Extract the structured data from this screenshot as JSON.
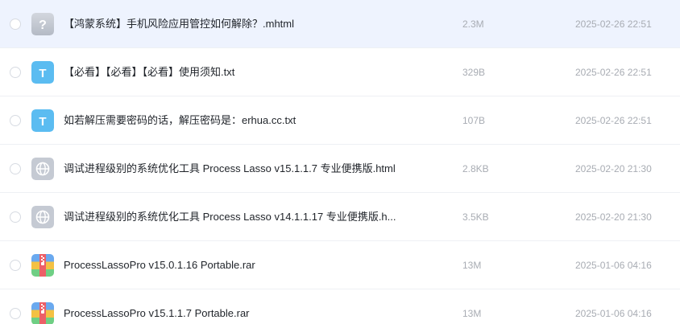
{
  "colors": {
    "selected_row_bg": "#eef3fe",
    "text_icon_bg": "#5bbcf1",
    "unknown_icon_bg": "#c2c7d1",
    "web_icon_bg": "#c5cad3",
    "secondary_text": "#a8acb3"
  },
  "files": [
    {
      "name": "【鸿蒙系统】手机风险应用管控如何解除？.mhtml",
      "size": "2.3M",
      "date": "2025-02-26 22:51",
      "icon": "unknown-file-icon",
      "selected": true
    },
    {
      "name": "【必看】【必看】【必看】使用须知.txt",
      "size": "329B",
      "date": "2025-02-26 22:51",
      "icon": "text-file-icon",
      "selected": false
    },
    {
      "name": "如若解压需要密码的话，解压密码是：erhua.cc.txt",
      "size": "107B",
      "date": "2025-02-26 22:51",
      "icon": "text-file-icon",
      "selected": false
    },
    {
      "name": "调试进程级别的系统优化工具 Process Lasso v15.1.1.7 专业便携版.html",
      "size": "2.8KB",
      "date": "2025-02-20 21:30",
      "icon": "web-file-icon",
      "selected": false
    },
    {
      "name": "调试进程级别的系统优化工具 Process Lasso v14.1.1.17 专业便携版.h...",
      "size": "3.5KB",
      "date": "2025-02-20 21:30",
      "icon": "web-file-icon",
      "selected": false
    },
    {
      "name": "ProcessLassoPro v15.0.1.16 Portable.rar",
      "size": "13M",
      "date": "2025-01-06 04:16",
      "icon": "archive-file-icon",
      "selected": false
    },
    {
      "name": "ProcessLassoPro v15.1.1.7 Portable.rar",
      "size": "13M",
      "date": "2025-01-06 04:16",
      "icon": "archive-file-icon",
      "selected": false
    }
  ],
  "icon_glyphs": {
    "unknown": "?",
    "text": "T"
  }
}
